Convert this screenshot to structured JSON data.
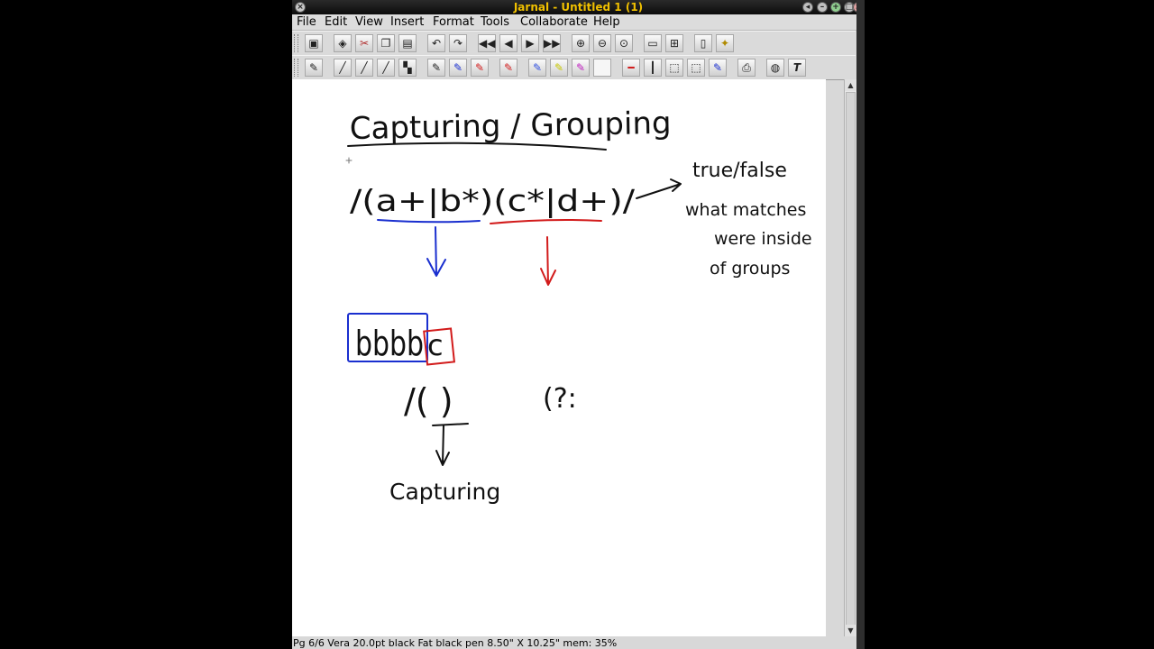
{
  "window": {
    "title": "Jarnal - Untitled 1 (1)"
  },
  "menu": [
    "File",
    "Edit",
    "View",
    "Insert",
    "Format",
    "Tools",
    "Collaborate",
    "Help"
  ],
  "status": {
    "text": "Pg 6/6 Vera 20.0pt black  Fat black pen  8.50\" X 10.25\"   mem: 35%"
  },
  "toolbar1_icons": [
    "page-icon",
    "eraser-icon",
    "cut-icon",
    "copy-icon",
    "paste-icon",
    "undo-icon",
    "redo-icon",
    "first-page-icon",
    "prev-page-icon",
    "next-page-icon",
    "last-page-icon",
    "zoom-in-icon",
    "zoom-out-icon",
    "zoom-fit-icon",
    "single-page-icon",
    "multi-page-icon",
    "new-page-icon",
    "insert-page-icon"
  ],
  "toolbar2_icons": [
    "pen-icon",
    "fine-pen-icon",
    "medium-pen-icon",
    "fat-pen-icon",
    "black-pen-icon",
    "dark-pen-icon",
    "blue-pen-icon",
    "red-pen-icon",
    "pen-color-icon",
    "blue-highlighter-icon",
    "yellow-highlighter-icon",
    "magenta-highlighter-icon",
    "white-tool-icon",
    "red-line-icon",
    "black-line-icon",
    "select-icon",
    "select-region-icon",
    "blue-marker-icon",
    "print-icon",
    "globe-icon",
    "text-tool-icon"
  ],
  "handwriting": {
    "title": "Capturing / Grouping",
    "regex": "/(a+|b*)(c*|d+)/",
    "note_lines": [
      "true/false",
      "what matches",
      "were inside",
      "of groups"
    ],
    "example": "bbbb",
    "example_tail": "c",
    "group_regex": "/( )",
    "noncapture_start": "(?:",
    "group_label": "Capturing"
  },
  "colors": {
    "ink_black": "#111111",
    "ink_blue": "#1a2fcf",
    "ink_red": "#d21b1b",
    "title_text": "#f0c000"
  }
}
